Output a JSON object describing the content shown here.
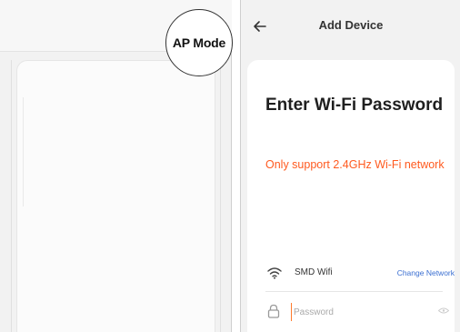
{
  "badge": {
    "label": "AP Mode"
  },
  "header": {
    "title": "Add Device"
  },
  "content": {
    "heading": "Enter Wi-Fi Password",
    "notice": "Only support 2.4GHz Wi-Fi network"
  },
  "wifi": {
    "icon": "wifi-icon",
    "network_name": "SMD Wifi",
    "change_label": "Change Network"
  },
  "password": {
    "icon": "lock-icon",
    "placeholder": "Password",
    "value": ""
  },
  "colors": {
    "accent": "#ff5a1f",
    "link": "#3b6fd1",
    "background": "#f2f2f2"
  }
}
